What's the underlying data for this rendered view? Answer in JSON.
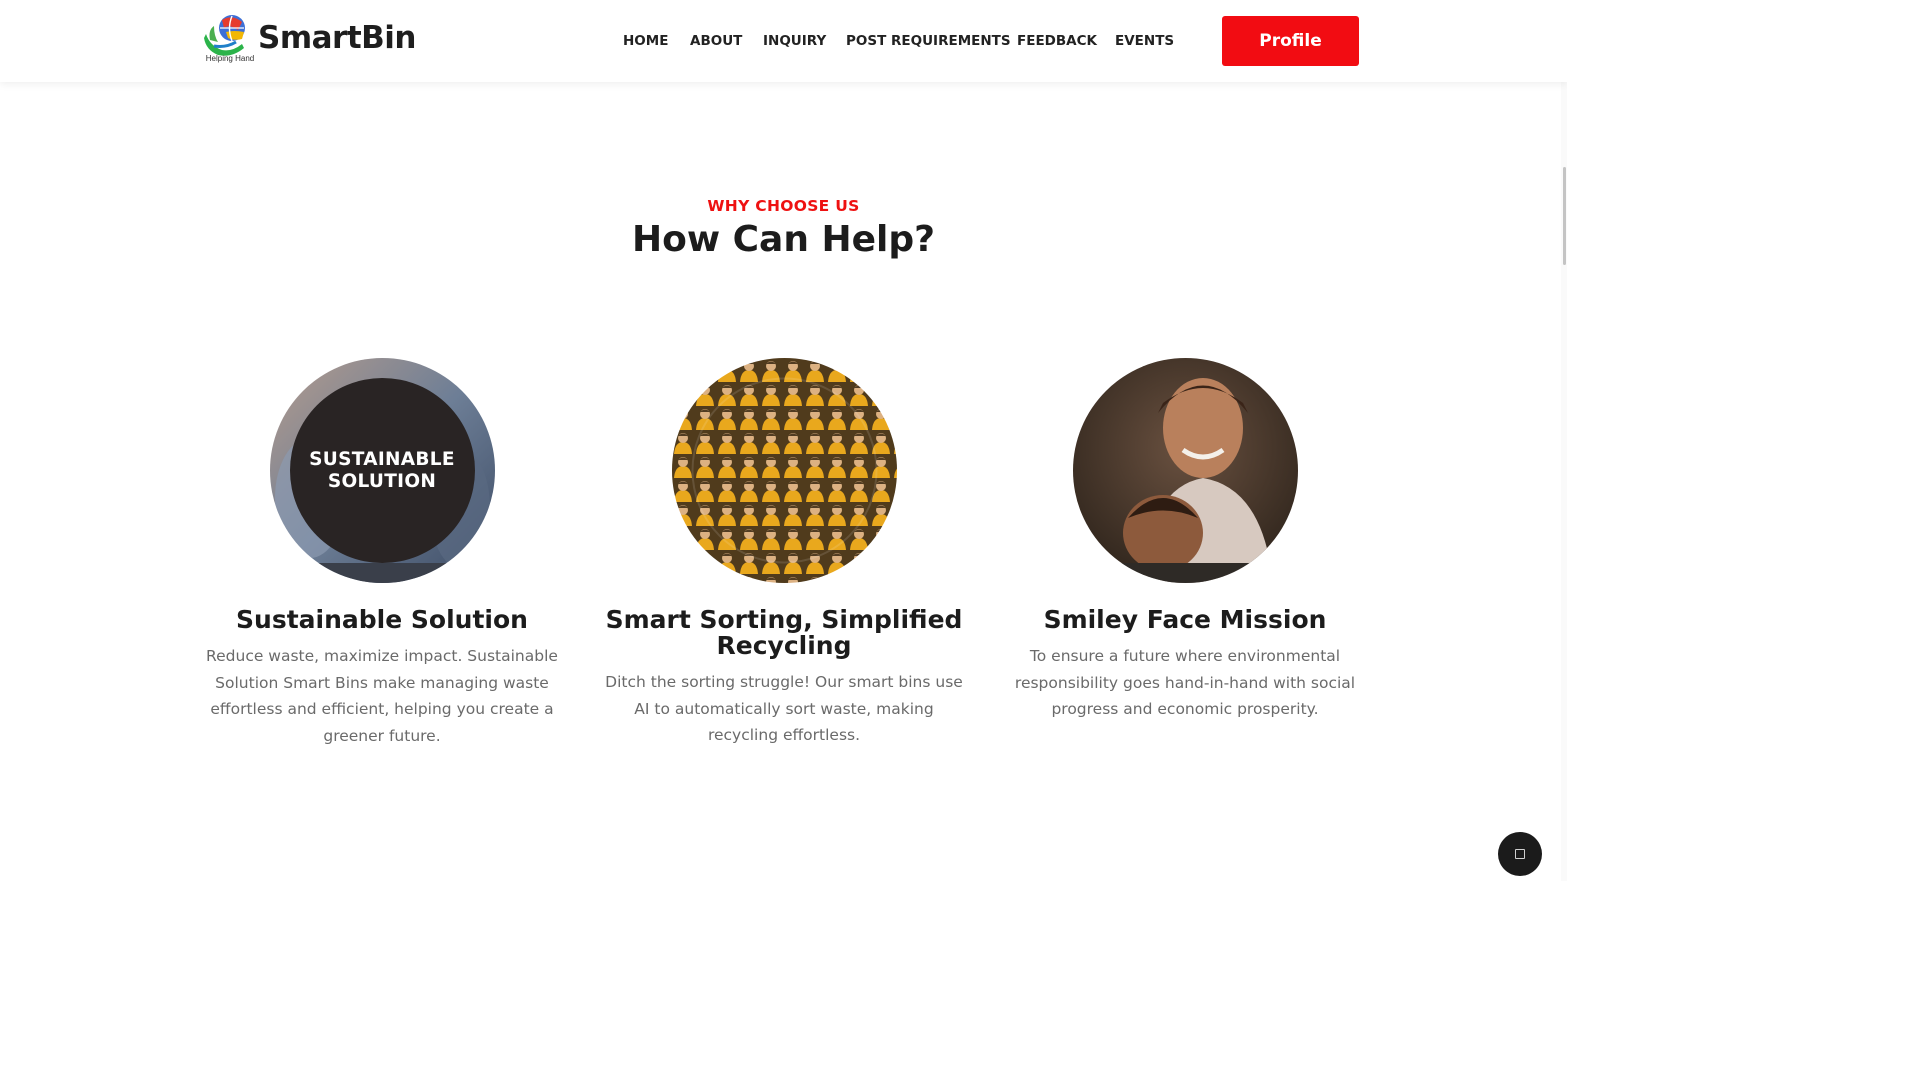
{
  "header": {
    "brand": "SmartBin",
    "tagline": "Helping Hand",
    "nav": [
      "HOME",
      "ABOUT",
      "INQUIRY",
      "POST REQUIREMENTS",
      "FEEDBACK",
      "EVENTS"
    ],
    "profile_label": "Profile"
  },
  "section": {
    "eyebrow": "WHY CHOOSE US",
    "title": "How Can Help?"
  },
  "cards": [
    {
      "overlay": "SUSTAINABLE SOLUTION",
      "title": "Sustainable Solution",
      "desc": "Reduce waste, maximize impact. Sustainable Solution Smart Bins make managing waste effortless and efficient, helping you create a greener future."
    },
    {
      "title": "Smart Sorting, Simplified Recycling",
      "desc": "Ditch the sorting struggle! Our smart bins use AI to automatically sort waste, making recycling effortless."
    },
    {
      "title": "Smiley Face Mission",
      "desc": "To ensure a future where environmental responsibility goes hand-in-hand with social progress and economic prosperity."
    }
  ],
  "colors": {
    "accent": "#f20c12",
    "eyebrow": "#ee1111",
    "dark": "#292424"
  }
}
